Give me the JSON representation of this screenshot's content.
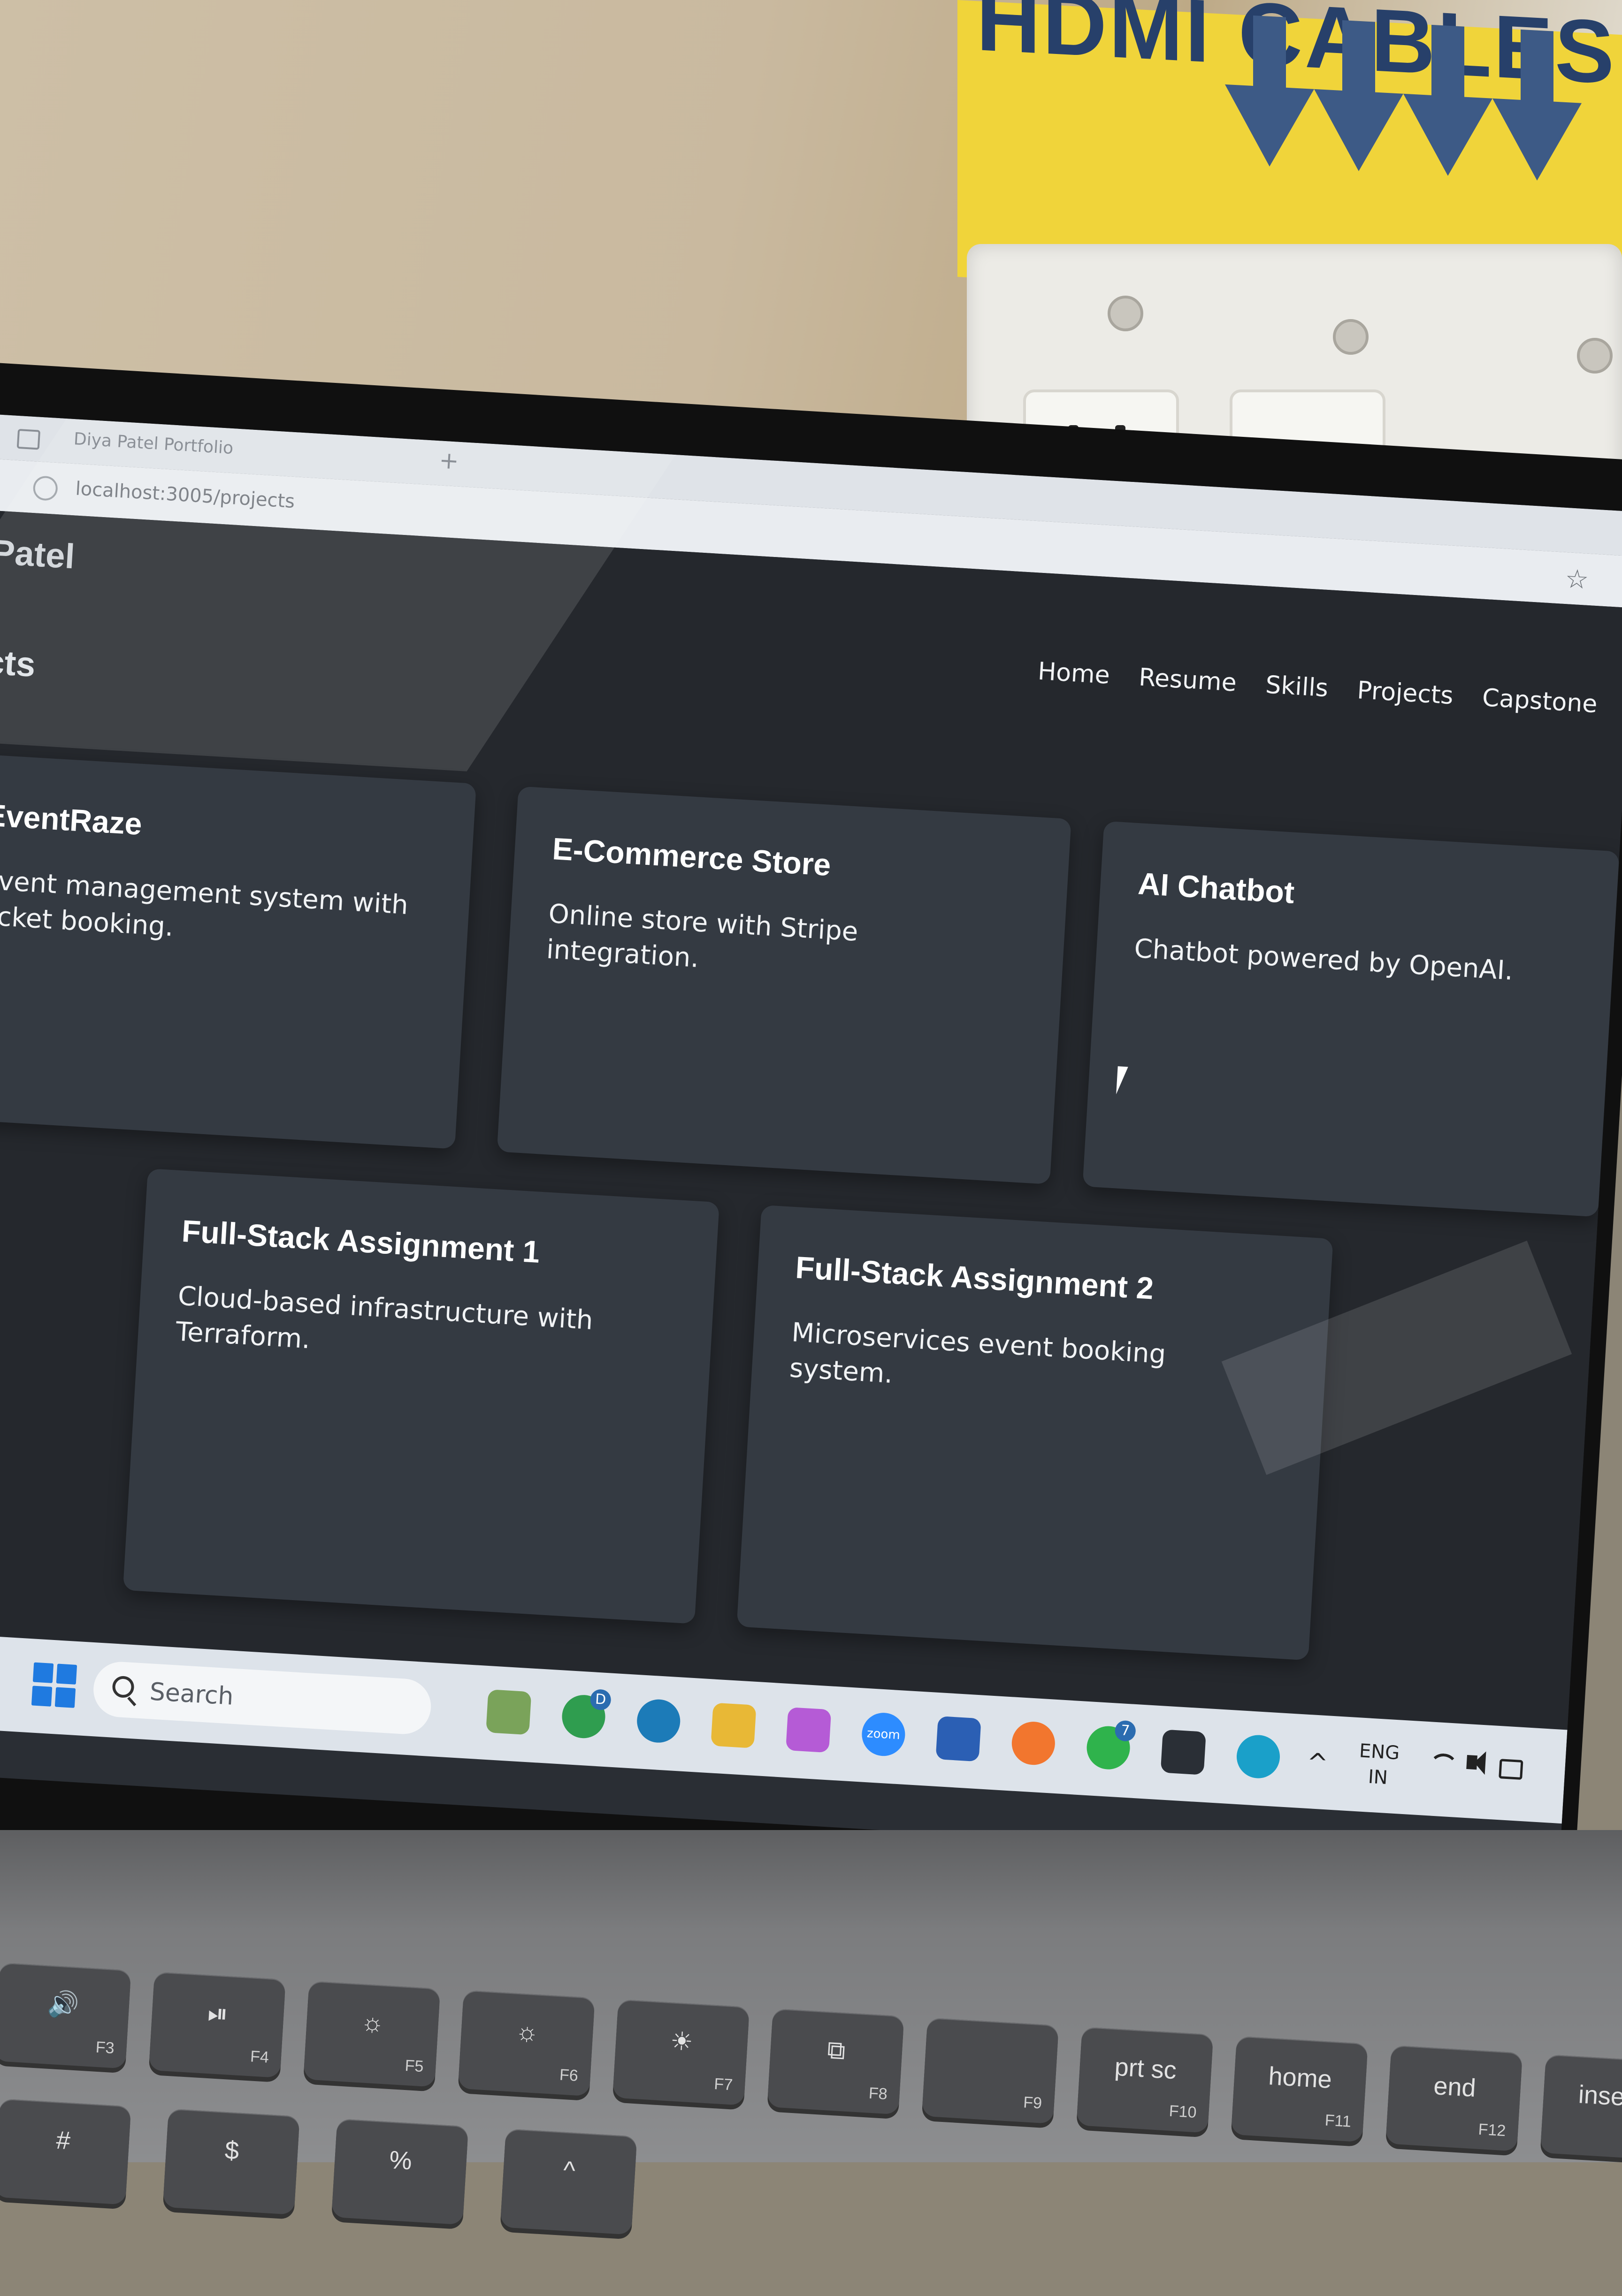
{
  "environment": {
    "sign_text": "HDMI CABLES PLU"
  },
  "browser": {
    "tab_title": "Diya Patel Portfolio",
    "url": "localhost:3005/projects"
  },
  "site": {
    "brand": "Patel",
    "section_title": "cts",
    "nav": [
      {
        "label": "Home"
      },
      {
        "label": "Resume"
      },
      {
        "label": "Skills"
      },
      {
        "label": "Projects"
      },
      {
        "label": "Capstone"
      }
    ],
    "projects": [
      {
        "title": "EventRaze",
        "description": "Event management system with ticket booking."
      },
      {
        "title": "E-Commerce Store",
        "description": "Online store with Stripe integration."
      },
      {
        "title": "AI Chatbot",
        "description": "Chatbot powered by OpenAI."
      },
      {
        "title": "Full-Stack Assignment 1",
        "description": "Cloud-based infrastructure with Terraform."
      },
      {
        "title": "Full-Stack Assignment 2",
        "description": "Microservices event booking system."
      }
    ]
  },
  "taskbar": {
    "search_label": "Search",
    "apps": [
      {
        "name": "widgets-icon",
        "color": "#7aa35a"
      },
      {
        "name": "chrome-icon",
        "color": "#2f9d4f",
        "badge": "D"
      },
      {
        "name": "edge-dev-icon",
        "color": "#1c7bb8"
      },
      {
        "name": "file-explorer-icon",
        "color": "#e8b836"
      },
      {
        "name": "copilot-icon",
        "color": "#b55bd6"
      },
      {
        "name": "zoom-icon",
        "color": "#2d8cff",
        "label": "zoom"
      },
      {
        "name": "microsoft-store-icon",
        "color": "#2b5fb4"
      },
      {
        "name": "firefox-icon",
        "color": "#f2762e"
      },
      {
        "name": "whatsapp-icon",
        "color": "#2fb34c",
        "badge": "7"
      },
      {
        "name": "terminal-icon",
        "color": "#2a2f36"
      },
      {
        "name": "edge-icon",
        "color": "#1aa0c9"
      }
    ],
    "tray": {
      "lang_top": "ENG",
      "lang_bottom": "IN"
    }
  },
  "keyboard": {
    "keys": [
      {
        "main": "🔊",
        "sub": "F3"
      },
      {
        "main": "⏯",
        "sub": "F4"
      },
      {
        "main": "☼",
        "sub": "F5"
      },
      {
        "main": "☼",
        "sub": "F6"
      },
      {
        "main": "☀",
        "sub": "F7"
      },
      {
        "main": "⧉",
        "sub": "F8"
      },
      {
        "main": "",
        "sub": "F9"
      },
      {
        "main": "prt sc",
        "sub": "F10"
      },
      {
        "main": "home",
        "sub": "F11"
      },
      {
        "main": "end",
        "sub": "F12"
      },
      {
        "main": "insert",
        "sub": ""
      }
    ],
    "row2": [
      "#",
      "$",
      "%",
      "^"
    ]
  }
}
